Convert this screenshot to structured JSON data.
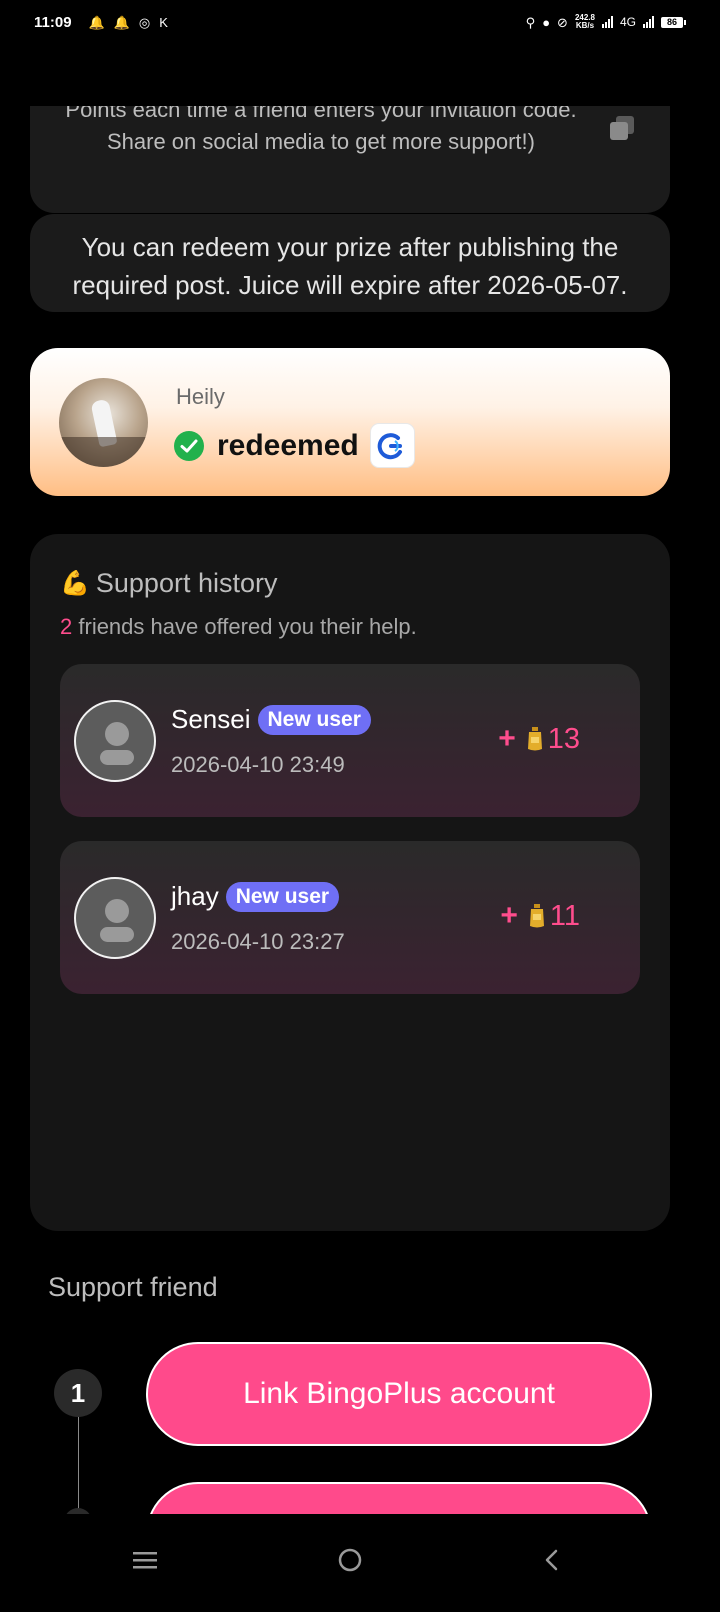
{
  "status_bar": {
    "time": "11:09",
    "net_speed_top": "242.8",
    "net_speed_bottom": "KB/s",
    "network": "4G",
    "battery": "86"
  },
  "invite": {
    "text_prefix": "Points each time a friend enters your invitation code. Share on social media to get more support!)"
  },
  "expire_notice": "You can redeem your prize after publishing the required post. Juice will expire after 2026-05-07.",
  "winner": {
    "name": "Heily",
    "status": "redeemed"
  },
  "history": {
    "title": "Support history",
    "count": "2",
    "subtitle": "friends have offered you their help.",
    "entries": [
      {
        "name": "Sensei",
        "badge": "New user",
        "time": "2026-04-10 23:49",
        "plus": "+",
        "points": "13"
      },
      {
        "name": "jhay",
        "badge": "New user",
        "time": "2026-04-10 23:27",
        "plus": "+",
        "points": "11"
      }
    ]
  },
  "support": {
    "title": "Support friend",
    "step1_number": "1",
    "step1_button": "Link BingoPlus account"
  },
  "colors": {
    "accent_pink": "#ff4a8b",
    "badge_purple": "#6f6ff5",
    "success_green": "#22b14c"
  },
  "icons": [
    "bell-icon",
    "location-icon",
    "key-icon",
    "mute-icon",
    "copy-icon",
    "check-circle-icon",
    "bingoplus-logo-icon",
    "muscle-icon",
    "user-placeholder-icon",
    "juice-icon",
    "menu-icon",
    "home-icon",
    "back-icon"
  ]
}
